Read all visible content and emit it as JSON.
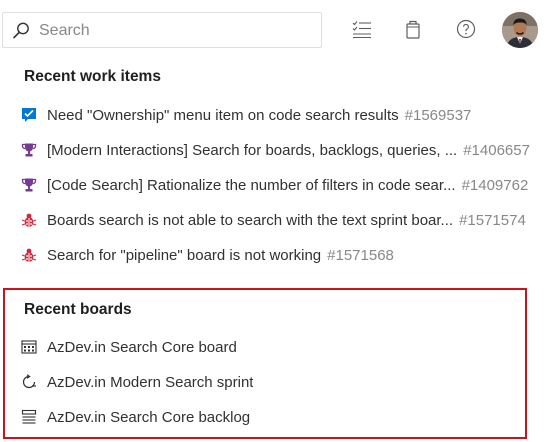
{
  "search": {
    "placeholder": "Search"
  },
  "toolbar": {
    "icons": [
      "work-items-list-icon",
      "shopping-bag-icon",
      "help-icon"
    ],
    "avatar_name": "user-avatar"
  },
  "recent_work_items": {
    "header": "Recent work items",
    "items": [
      {
        "type": "task",
        "icon": "task-check-icon",
        "color": "#0078d4",
        "title": "Need \"Ownership\" menu item on code search results",
        "id": "#1569537"
      },
      {
        "type": "feature",
        "icon": "trophy-icon",
        "color": "#773b93",
        "title": "[Modern Interactions] Search for boards, backlogs, queries, ...",
        "id": "#1406657"
      },
      {
        "type": "feature",
        "icon": "trophy-icon",
        "color": "#773b93",
        "title": "[Code Search] Rationalize the number of filters in code sear...",
        "id": "#1409762"
      },
      {
        "type": "bug",
        "icon": "bug-icon",
        "color": "#cc293d",
        "title": "Boards search is not able to search with the text sprint boar...",
        "id": "#1571574"
      },
      {
        "type": "bug",
        "icon": "bug-icon",
        "color": "#cc293d",
        "title": "Search for \"pipeline\" board is not working",
        "id": "#1571568"
      }
    ]
  },
  "recent_boards": {
    "header": "Recent boards",
    "highlight_color": "#d0101b",
    "items": [
      {
        "icon": "board-grid-icon",
        "title": "AzDev.in Search Core board"
      },
      {
        "icon": "sprint-cycle-icon",
        "title": "AzDev.in Modern Search sprint"
      },
      {
        "icon": "backlog-list-icon",
        "title": "AzDev.in Search Core backlog"
      }
    ]
  }
}
